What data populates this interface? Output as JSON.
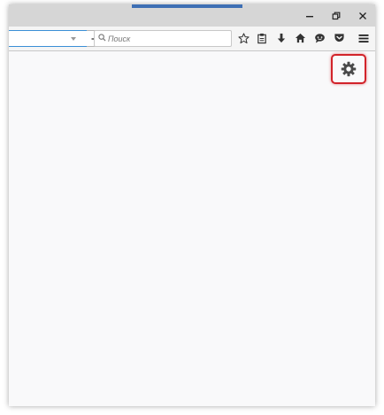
{
  "window": {
    "controls": {
      "minimize_icon": "minimize-icon",
      "restore_icon": "restore-icon",
      "close_icon": "close-icon"
    },
    "active_tab_color": "#3e6fb4"
  },
  "toolbar": {
    "url": {
      "value": "",
      "accent_color": "#3b8fd6"
    },
    "search": {
      "placeholder": "Поиск"
    },
    "icons": [
      "bookmark-star-icon",
      "reading-list-icon",
      "download-icon",
      "home-icon",
      "chat-icon",
      "pocket-icon",
      "menu-icon"
    ]
  },
  "content": {
    "settings_button": {
      "icon": "gear-icon",
      "highlight_color": "#d2232a"
    }
  }
}
